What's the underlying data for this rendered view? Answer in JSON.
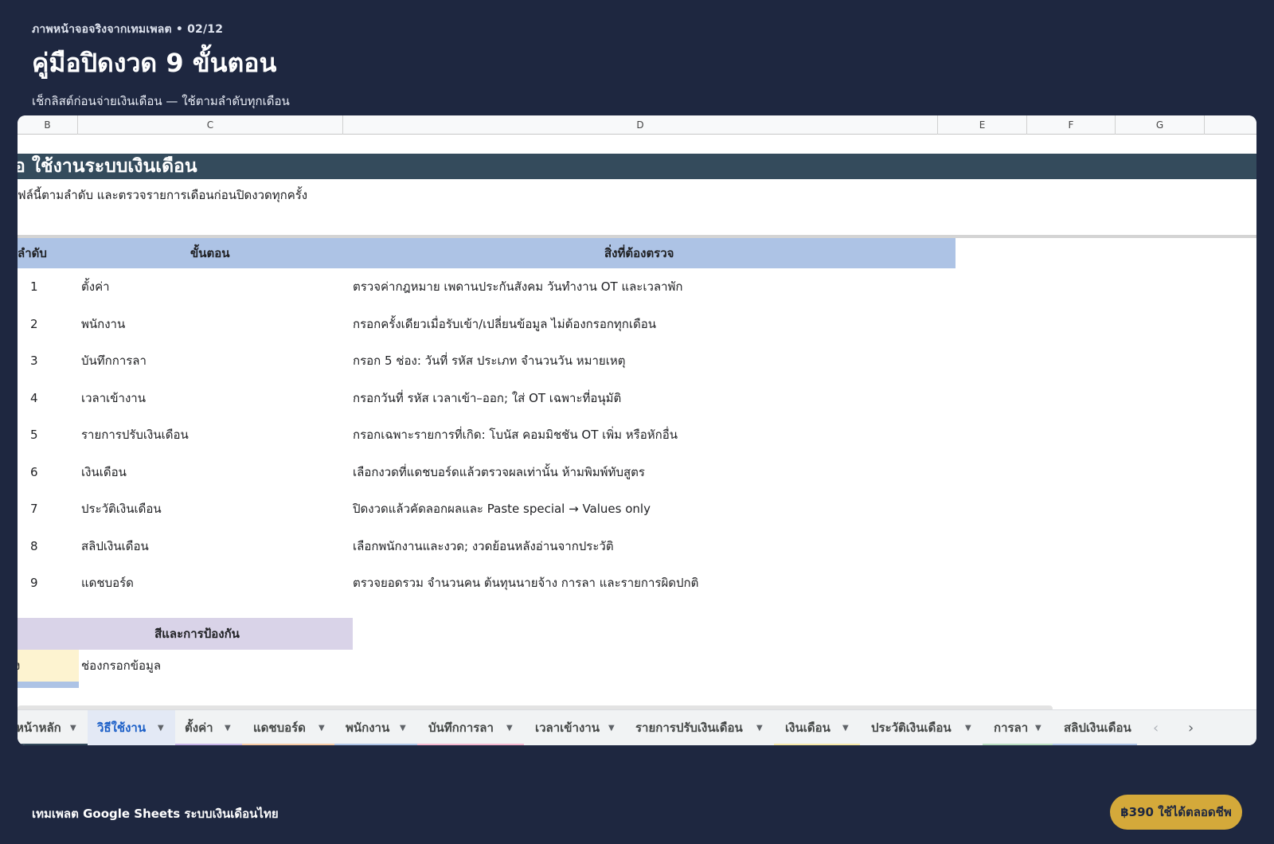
{
  "hero": {
    "kicker": "ภาพหน้าจอจริงจากเทมเพลต • 02/12",
    "title": "คู่มือปิดงวด 9 ขั้นตอน",
    "subtitle": "เช็กลิสต์ก่อนจ่ายเงินเดือน — ใช้ตามลำดับทุกเดือน"
  },
  "columns": [
    "B",
    "C",
    "D",
    "E",
    "F",
    "G"
  ],
  "sheet": {
    "banner": "อ ใช้งานระบบเงินเดือน",
    "note": "ฟล์นี้ตามลำดับ และตรวจรายการเดือนก่อนปิดงวดทุกครั้ง",
    "headers": {
      "num": "ลำดับ",
      "step": "ขั้นตอน",
      "check": "สิ่งที่ต้องตรวจ"
    },
    "rows": [
      {
        "num": "1",
        "step": "ตั้งค่า",
        "check": "ตรวจค่ากฎหมาย เพดานประกันสังคม วันทำงาน OT และเวลาพัก"
      },
      {
        "num": "2",
        "step": "พนักงาน",
        "check": "กรอกครั้งเดียวเมื่อรับเข้า/เปลี่ยนข้อมูล ไม่ต้องกรอกทุกเดือน"
      },
      {
        "num": "3",
        "step": "บันทึกการลา",
        "check": "กรอก 5 ช่อง: วันที่ รหัส ประเภท จำนวนวัน หมายเหตุ"
      },
      {
        "num": "4",
        "step": "เวลาเข้างาน",
        "check": "กรอกวันที่ รหัส เวลาเข้า–ออก; ใส่ OT เฉพาะที่อนุมัติ"
      },
      {
        "num": "5",
        "step": "รายการปรับเงินเดือน",
        "check": "กรอกเฉพาะรายการที่เกิด: โบนัส คอมมิชชัน OT เพิ่ม หรือหักอื่น"
      },
      {
        "num": "6",
        "step": "เงินเดือน",
        "check": "เลือกงวดที่แดชบอร์ดแล้วตรวจผลเท่านั้น ห้ามพิมพ์ทับสูตร"
      },
      {
        "num": "7",
        "step": "ประวัติเงินเดือน",
        "check": "ปิดงวดแล้วคัดลอกผลและ Paste special → Values only"
      },
      {
        "num": "8",
        "step": "สลิปเงินเดือน",
        "check": "เลือกพนักงานและงวด; งวดย้อนหลังอ่านจากประวัติ"
      },
      {
        "num": "9",
        "step": "แดชบอร์ด",
        "check": "ตรวจยอดรวม จำนวนคน ต้นทุนนายจ้าง การลา และรายการผิดปกติ"
      }
    ],
    "legend": {
      "title": "สีและการป้องกัน",
      "swatch_label": "ง",
      "swatch_text": "ช่องกรอกข้อมูล"
    }
  },
  "tabs": [
    {
      "label": "หน้าหลัก",
      "color": "#344b5c"
    },
    {
      "label": "วิธีใช้งาน",
      "color": "#1a5ec7",
      "active": true
    },
    {
      "label": "ตั้งค่า",
      "color": "#c6b3e6"
    },
    {
      "label": "แดชบอร์ด",
      "color": "#f6c9a3"
    },
    {
      "label": "พนักงาน",
      "color": "#adc3e5"
    },
    {
      "label": "บันทึกการลา",
      "color": "#f5b7cf"
    },
    {
      "label": "เวลาเข้างาน",
      "color": ""
    },
    {
      "label": "รายการปรับเงินเดือน",
      "color": ""
    },
    {
      "label": "เงินเดือน",
      "color": "#f7e9a8"
    },
    {
      "label": "ประวัติเงินเดือน",
      "color": ""
    },
    {
      "label": "การลา",
      "color": "#b7dcbf"
    },
    {
      "label": "สลิปเงินเดือน",
      "color": "#adc3e5"
    }
  ],
  "footer": {
    "text": "เทมเพลต Google Sheets ระบบเงินเดือนไทย",
    "price_button": "฿390 ใช้ได้ตลอดชีพ"
  }
}
